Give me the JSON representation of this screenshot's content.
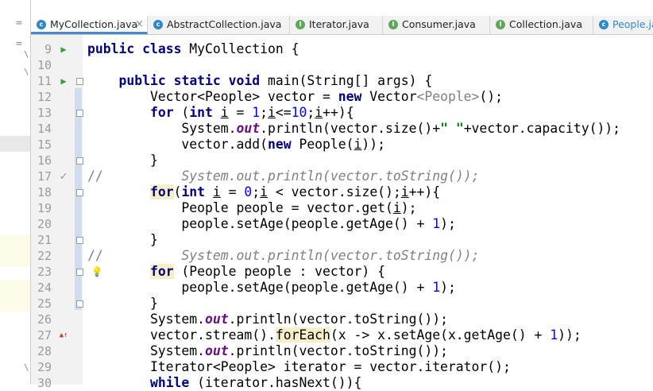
{
  "tabs": [
    {
      "label": "MyCollection.java",
      "icon": "class-icon",
      "active": true
    },
    {
      "label": "AbstractCollection.java",
      "icon": "class-icon"
    },
    {
      "label": "Iterator.java",
      "icon": "interface-icon"
    },
    {
      "label": "Consumer.java",
      "icon": "interface-icon"
    },
    {
      "label": "Collection.java",
      "icon": "interface-icon"
    },
    {
      "label": "People.ja",
      "icon": "class-icon"
    }
  ],
  "tab_icon_letters": {
    "class": "c",
    "interface": "I"
  },
  "tab_close_glyph": "×",
  "left_strip_marks": [
    "=",
    "=",
    "\\",
    "\\",
    "\\"
  ],
  "gutter": {
    "line_numbers": [
      "9",
      "10",
      "11",
      "12",
      "13",
      "14",
      "15",
      "16",
      "17",
      "18",
      "19",
      "20",
      "21",
      "22",
      "23",
      "24",
      "25",
      "26",
      "27",
      "28",
      "29",
      "30"
    ],
    "icons": {
      "run": "▶",
      "check": "✓",
      "override": "▲↑",
      "bulb": "💡"
    }
  },
  "code_lines": [
    "public class MyCollection {",
    "",
    "    public static void main(String[] args) {",
    "        Vector<People> vector = new Vector<People>();",
    "        for (int i = 1;i<=10;i++){",
    "            System.out.println(vector.size()+\" \"+vector.capacity());",
    "            vector.add(new People(i));",
    "        }",
    "//          System.out.println(vector.toString());",
    "        for(int i = 0;i < vector.size();i++){",
    "            People people = vector.get(i);",
    "            people.setAge(people.getAge() + 1);",
    "        }",
    "//          System.out.println(vector.toString());",
    "        for (People people : vector) {",
    "            people.setAge(people.getAge() + 1);",
    "        }",
    "        System.out.println(vector.toString());",
    "        vector.stream().forEach(x -> x.setAge(x.getAge() + 1));",
    "        System.out.println(vector.toString());",
    "        Iterator<People> iterator = vector.iterator();",
    "        while (iterator.hasNext()){"
  ],
  "colors": {
    "keyword": "#000080",
    "number": "#0000ff",
    "string": "#008000",
    "static_field": "#660e7a",
    "comment": "#808080",
    "gutter_bg": "#f2f2f2",
    "fold_bar": "#cfdded",
    "active_tab_underline": "#4a88c7",
    "highlight": "#f6efc7"
  }
}
